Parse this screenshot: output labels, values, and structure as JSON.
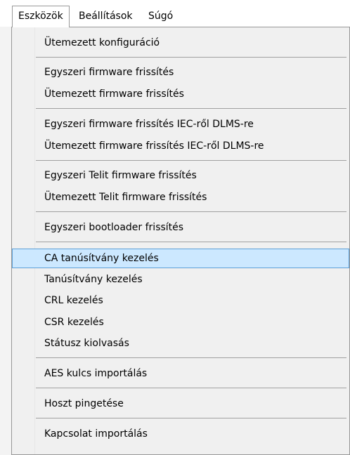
{
  "menubar": {
    "items": [
      {
        "label": "Eszközök",
        "active": true
      },
      {
        "label": "Beállítások",
        "active": false
      },
      {
        "label": "Súgó",
        "active": false
      }
    ]
  },
  "dropdown": {
    "items": [
      {
        "label": "Ütemezett konfiguráció"
      },
      {
        "label": "Egyszeri firmware frissítés"
      },
      {
        "label": "Ütemezett firmware frissítés"
      },
      {
        "label": "Egyszeri firmware frissítés IEC-ről DLMS-re"
      },
      {
        "label": "Ütemezett firmware frissítés IEC-ről DLMS-re"
      },
      {
        "label": "Egyszeri Telit firmware frissítés"
      },
      {
        "label": "Ütemezett Telit firmware frissítés"
      },
      {
        "label": "Egyszeri bootloader frissítés"
      },
      {
        "label": "CA tanúsítvány kezelés",
        "highlighted": true
      },
      {
        "label": "Tanúsítvány kezelés"
      },
      {
        "label": "CRL kezelés"
      },
      {
        "label": "CSR kezelés"
      },
      {
        "label": "Státusz kiolvasás"
      },
      {
        "label": "AES kulcs importálás"
      },
      {
        "label": "Hoszt pingetése"
      },
      {
        "label": "Kapcsolat importálás"
      }
    ]
  },
  "colors": {
    "highlight_bg": "#cce8ff",
    "highlight_border": "#5da0d8",
    "menu_bg": "#f0f0f0"
  }
}
